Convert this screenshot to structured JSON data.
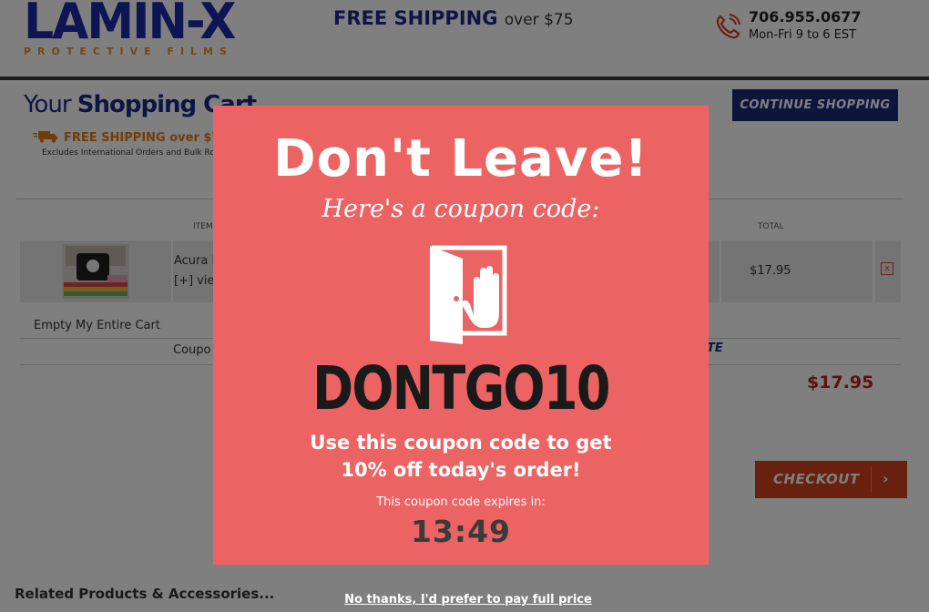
{
  "header": {
    "logo_text": "LAMIN-X",
    "logo_sub": "PROTECTIVE FILMS",
    "promo_bold": "FREE SHIPPING",
    "promo_rest": "over $75",
    "phone": "706.955.0677",
    "hours": "Mon-Fri 9 to 6 EST"
  },
  "cart": {
    "title_prefix": "Your",
    "title_main": "Shopping Cart",
    "continue_label": "CONTINUE SHOPPING",
    "free_shipping": "FREE SHIPPING over $75",
    "excludes": "Excludes International Orders and Bulk Rolls",
    "col_item": "ITEM",
    "col_total": "TOTAL",
    "item_name": "Acura I",
    "item_view": "[+] view",
    "item_total": "$17.95",
    "remove": "x",
    "empty_cart": "Empty My Entire Cart",
    "coupon_label": "Coupo",
    "update_label": "TE",
    "grand_total": "$17.95",
    "checkout_label": "CHECKOUT",
    "related": "Related Products & Accessories..."
  },
  "modal": {
    "title": "Don't Leave!",
    "subtitle": "Here's a coupon code:",
    "code": "DONTGO10",
    "offer_line1": "Use this coupon code to get",
    "offer_line2": "10% off today's order!",
    "expires_text": "This coupon code expires in:",
    "timer": "13:49",
    "decline": "No thanks, I'd prefer to pay full price"
  },
  "colors": {
    "brand_blue": "#1c2aa8",
    "modal_bg": "#ec6363",
    "checkout_bg": "#d1421f",
    "total_red": "#c02020"
  },
  "icons": [
    "phone-icon",
    "truck-icon",
    "door-hand-icon",
    "chevron-right-icon"
  ]
}
